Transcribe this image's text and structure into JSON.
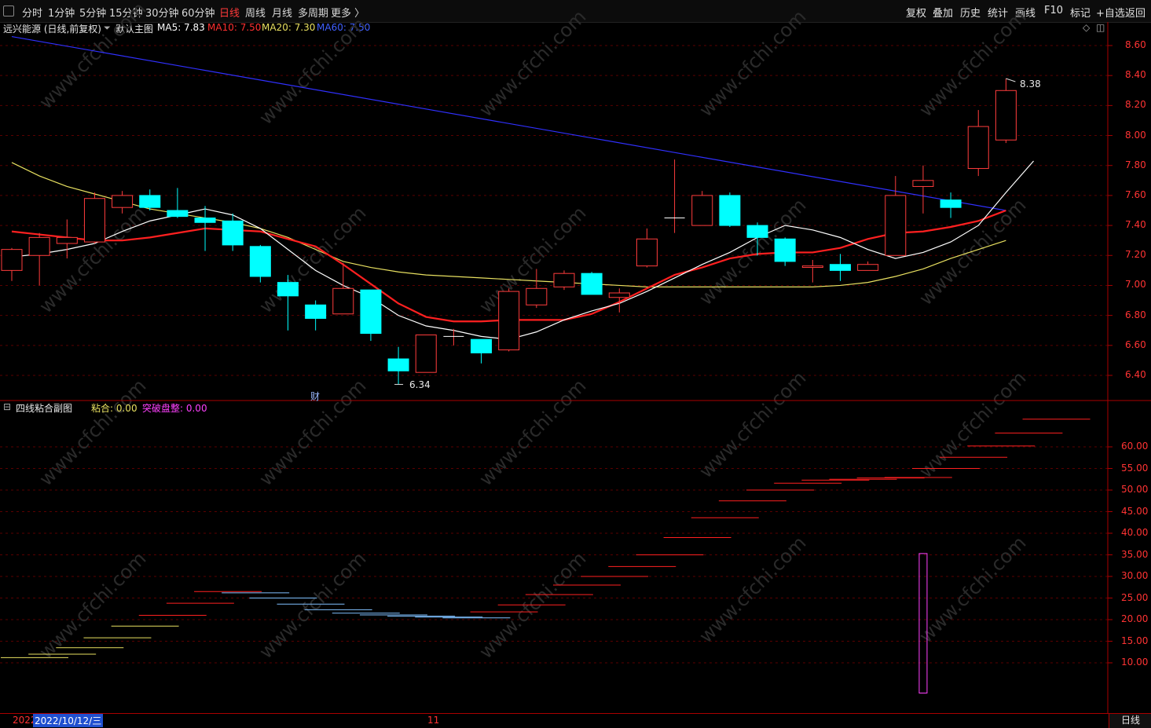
{
  "toolbar": {
    "periods": [
      "分时",
      "1分钟",
      "5分钟",
      "15分钟",
      "30分钟",
      "60分钟",
      "日线",
      "周线",
      "月线",
      "多周期",
      "更多 〉"
    ],
    "active_period": "日线",
    "right_buttons": [
      "复权",
      "叠加",
      "历史",
      "统计",
      "画线",
      "F10",
      "标记",
      "+自选",
      "返回"
    ]
  },
  "main_chart": {
    "stock_title": "远兴能源 (日线,前复权)",
    "template_label": "默认主图",
    "ma5": "MA5: 7.83",
    "ma10": "MA10: 7.50",
    "ma20": "MA20: 7.30",
    "ma60": "MA60: 7.50",
    "y_ticks": [
      "8.60",
      "8.40",
      "8.20",
      "8.00",
      "7.80",
      "7.60",
      "7.40",
      "7.20",
      "7.00",
      "6.80",
      "6.60",
      "6.40"
    ],
    "high_label": "8.38",
    "low_label": "6.34",
    "finance_marker": "财"
  },
  "sub_chart": {
    "title": "四线粘合副图",
    "nianhe": "粘合: 0.00",
    "tupo": "突破盘整: 0.00",
    "y_ticks": [
      "60.00",
      "55.00",
      "50.00",
      "45.00",
      "40.00",
      "35.00",
      "30.00",
      "25.00",
      "20.00",
      "15.00",
      "10.00"
    ]
  },
  "bottom": {
    "date_label": "2022/10/12/三",
    "year_label": "2022",
    "month_label": "11",
    "period_tab": "日线"
  },
  "watermark": "www.cfchi.com",
  "colors": {
    "up": "#ff3c3c",
    "down": "#00ffff",
    "ma5": "#ffffff",
    "ma10": "#ff2020",
    "ma20": "#e8e060",
    "ma60": "#3030ff",
    "active": "#ff3a3a"
  },
  "chart_data": {
    "type": "candlestick",
    "y_range": [
      6.25,
      8.65
    ],
    "candles": [
      {
        "o": 7.1,
        "c": 7.24,
        "h": 7.25,
        "l": 7.03
      },
      {
        "o": 7.2,
        "c": 7.32,
        "h": 7.35,
        "l": 7.0
      },
      {
        "o": 7.28,
        "c": 7.32,
        "h": 7.44,
        "l": 7.18
      },
      {
        "o": 7.29,
        "c": 7.58,
        "h": 7.62,
        "l": 7.28
      },
      {
        "o": 7.52,
        "c": 7.6,
        "h": 7.63,
        "l": 7.48
      },
      {
        "o": 7.6,
        "c": 7.52,
        "h": 7.64,
        "l": 7.5
      },
      {
        "o": 7.5,
        "c": 7.46,
        "h": 7.65,
        "l": 7.45
      },
      {
        "o": 7.45,
        "c": 7.42,
        "h": 7.53,
        "l": 7.23
      },
      {
        "o": 7.43,
        "c": 7.27,
        "h": 7.48,
        "l": 7.23
      },
      {
        "o": 7.26,
        "c": 7.06,
        "h": 7.27,
        "l": 7.02
      },
      {
        "o": 7.02,
        "c": 6.93,
        "h": 7.07,
        "l": 6.7
      },
      {
        "o": 6.87,
        "c": 6.78,
        "h": 6.9,
        "l": 6.7
      },
      {
        "o": 6.81,
        "c": 6.98,
        "h": 7.15,
        "l": 6.81
      },
      {
        "o": 6.97,
        "c": 6.68,
        "h": 6.97,
        "l": 6.63
      },
      {
        "o": 6.51,
        "c": 6.43,
        "h": 6.59,
        "l": 6.34
      },
      {
        "o": 6.42,
        "c": 6.67,
        "h": 6.67,
        "l": 6.42
      },
      {
        "o": 6.66,
        "c": 6.66,
        "h": 6.71,
        "l": 6.6
      },
      {
        "o": 6.64,
        "c": 6.55,
        "h": 6.64,
        "l": 6.48
      },
      {
        "o": 6.57,
        "c": 6.96,
        "h": 6.98,
        "l": 6.56
      },
      {
        "o": 6.87,
        "c": 6.98,
        "h": 7.11,
        "l": 6.85
      },
      {
        "o": 6.99,
        "c": 7.08,
        "h": 7.1,
        "l": 6.97
      },
      {
        "o": 7.08,
        "c": 6.94,
        "h": 7.09,
        "l": 6.94
      },
      {
        "o": 6.92,
        "c": 6.95,
        "h": 6.98,
        "l": 6.82
      },
      {
        "o": 7.13,
        "c": 7.31,
        "h": 7.38,
        "l": 7.12
      },
      {
        "o": 7.45,
        "c": 7.45,
        "h": 7.84,
        "l": 7.35
      },
      {
        "o": 7.4,
        "c": 7.6,
        "h": 7.63,
        "l": 7.4
      },
      {
        "o": 7.6,
        "c": 7.4,
        "h": 7.62,
        "l": 7.39
      },
      {
        "o": 7.4,
        "c": 7.32,
        "h": 7.42,
        "l": 7.2
      },
      {
        "o": 7.31,
        "c": 7.16,
        "h": 7.32,
        "l": 7.13
      },
      {
        "o": 7.12,
        "c": 7.13,
        "h": 7.17,
        "l": 7.02
      },
      {
        "o": 7.14,
        "c": 7.1,
        "h": 7.21,
        "l": 7.03
      },
      {
        "o": 7.1,
        "c": 7.14,
        "h": 7.16,
        "l": 7.1
      },
      {
        "o": 7.2,
        "c": 7.6,
        "h": 7.73,
        "l": 7.2
      },
      {
        "o": 7.66,
        "c": 7.7,
        "h": 7.8,
        "l": 7.48
      },
      {
        "o": 7.57,
        "c": 7.52,
        "h": 7.62,
        "l": 7.45
      },
      {
        "o": 7.78,
        "c": 8.06,
        "h": 8.17,
        "l": 7.73
      },
      {
        "o": 7.97,
        "c": 8.3,
        "h": 8.38,
        "l": 7.95
      }
    ],
    "ma5": [
      7.19,
      7.21,
      7.24,
      7.28,
      7.36,
      7.43,
      7.47,
      7.51,
      7.47,
      7.38,
      7.24,
      7.1,
      7.0,
      6.92,
      6.8,
      6.73,
      6.7,
      6.66,
      6.64,
      6.69,
      6.77,
      6.83,
      6.88,
      6.96,
      7.05,
      7.14,
      7.22,
      7.32,
      7.4,
      7.37,
      7.32,
      7.24,
      7.18,
      7.22,
      7.29,
      7.4,
      7.62,
      7.83
    ],
    "ma10": [
      7.36,
      7.34,
      7.32,
      7.3,
      7.3,
      7.32,
      7.35,
      7.38,
      7.37,
      7.36,
      7.31,
      7.26,
      7.14,
      7.01,
      6.88,
      6.79,
      6.76,
      6.76,
      6.77,
      6.77,
      6.77,
      6.81,
      6.89,
      6.98,
      7.07,
      7.12,
      7.18,
      7.21,
      7.22,
      7.22,
      7.25,
      7.31,
      7.35,
      7.36,
      7.39,
      7.43,
      7.5
    ],
    "ma20": [
      7.82,
      7.73,
      7.66,
      7.61,
      7.56,
      7.51,
      7.48,
      7.45,
      7.42,
      7.38,
      7.32,
      7.24,
      7.16,
      7.12,
      7.09,
      7.07,
      7.06,
      7.05,
      7.04,
      7.03,
      7.02,
      7.01,
      7.0,
      6.99,
      6.99,
      6.99,
      6.99,
      6.99,
      6.99,
      6.99,
      7.0,
      7.02,
      7.06,
      7.11,
      7.18,
      7.24,
      7.3
    ],
    "ma60": [
      8.66,
      7.5
    ],
    "sub_ladder": [
      {
        "y": 11.2,
        "c": "yellow"
      },
      {
        "y": 12.0,
        "c": "yellow"
      },
      {
        "y": 13.5,
        "c": "yellow"
      },
      {
        "y": 15.8,
        "c": "yellow"
      },
      {
        "y": 18.5,
        "c": "yellow"
      },
      {
        "y": 21.0,
        "c": "red"
      },
      {
        "y": 23.8,
        "c": "red"
      },
      {
        "y": 26.5,
        "c": "red"
      },
      {
        "y": 26.2,
        "c": "blue"
      },
      {
        "y": 25.0,
        "c": "blue"
      },
      {
        "y": 23.6,
        "c": "blue"
      },
      {
        "y": 22.3,
        "c": "blue"
      },
      {
        "y": 21.5,
        "c": "blue"
      },
      {
        "y": 21.1,
        "c": "blue"
      },
      {
        "y": 20.8,
        "c": "blue"
      },
      {
        "y": 20.6,
        "c": "blue"
      },
      {
        "y": 20.4,
        "c": "blue"
      },
      {
        "y": 21.8,
        "c": "red"
      },
      {
        "y": 23.4,
        "c": "red"
      },
      {
        "y": 25.8,
        "c": "red"
      },
      {
        "y": 28.0,
        "c": "red"
      },
      {
        "y": 30.0,
        "c": "red"
      },
      {
        "y": 32.3,
        "c": "red"
      },
      {
        "y": 35.0,
        "c": "red"
      },
      {
        "y": 39.0,
        "c": "red"
      },
      {
        "y": 43.6,
        "c": "red"
      },
      {
        "y": 47.5,
        "c": "red"
      },
      {
        "y": 50.0,
        "c": "red"
      },
      {
        "y": 51.6,
        "c": "red"
      },
      {
        "y": 52.3,
        "c": "red"
      },
      {
        "y": 52.5,
        "c": "red"
      },
      {
        "y": 52.8,
        "c": "red"
      },
      {
        "y": 52.9,
        "c": "red"
      },
      {
        "y": 55.0,
        "c": "red"
      },
      {
        "y": 57.6,
        "c": "red"
      },
      {
        "y": 60.2,
        "c": "red"
      },
      {
        "y": 63.2,
        "c": "red"
      },
      {
        "y": 66.4,
        "c": "red"
      }
    ],
    "sub_range": [
      3.0,
      70.0
    ],
    "sub_spike": {
      "index": 33,
      "value": 35.3
    }
  }
}
